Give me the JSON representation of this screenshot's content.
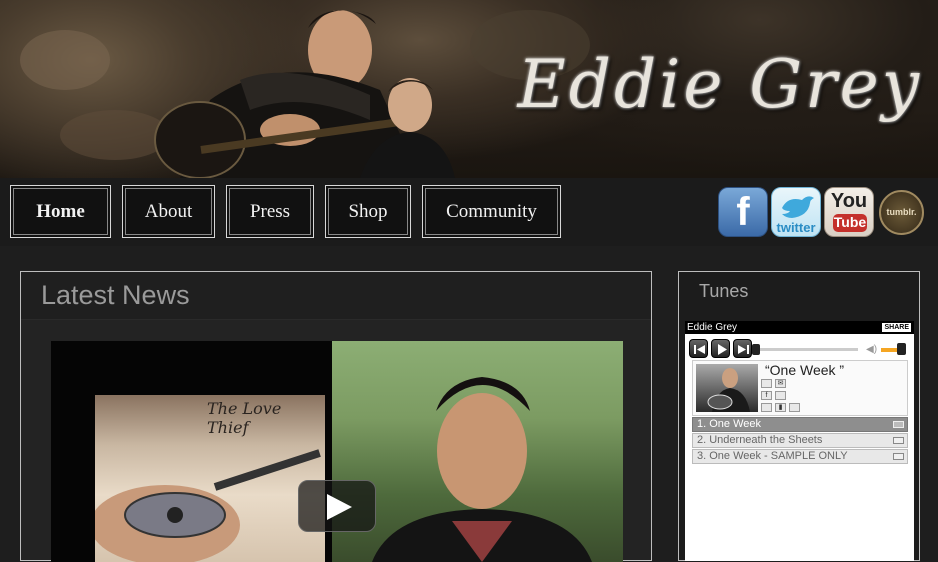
{
  "header": {
    "site_title": "Eddie Grey"
  },
  "nav": {
    "items": [
      {
        "label": "Home",
        "active": true
      },
      {
        "label": "About",
        "active": false
      },
      {
        "label": "Press",
        "active": false
      },
      {
        "label": "Shop",
        "active": false
      },
      {
        "label": "Community",
        "active": false
      }
    ]
  },
  "social": {
    "facebook_glyph": "f",
    "twitter_label": "twitter",
    "youtube_you": "You",
    "youtube_tube": "Tube",
    "tumblr_label": "tumblr."
  },
  "main": {
    "title": "Latest News",
    "video": {
      "thumbnail_caption": "The Love Thief"
    }
  },
  "sidebar": {
    "title": "Tunes",
    "player": {
      "artist": "Eddie Grey",
      "share_label": "SHARE",
      "now_playing_title": "“One Week ”",
      "track_playing_index": 0,
      "volume_percent": 80,
      "tracks": [
        {
          "label": "1. One Week"
        },
        {
          "label": "2. Underneath the Sheets"
        },
        {
          "label": "3. One Week - SAMPLE ONLY"
        }
      ]
    }
  },
  "colors": {
    "background": "#1e1e1e",
    "panel_border": "#bdbdbd",
    "volume_accent": "#f5a623",
    "active_track": "#8e8e8e"
  },
  "icons": [
    "facebook-icon",
    "twitter-icon",
    "youtube-icon",
    "tumblr-icon",
    "play-icon",
    "prev-icon",
    "next-icon",
    "volume-icon",
    "mail-icon"
  ]
}
